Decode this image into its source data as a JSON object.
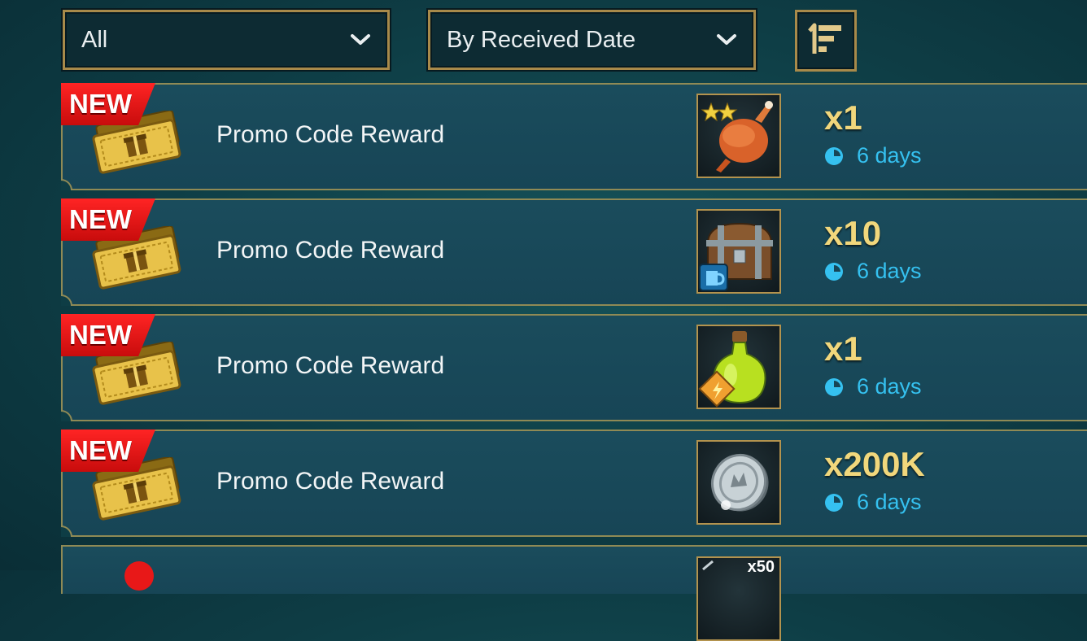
{
  "filters": {
    "category": "All",
    "sort_by": "By Received Date",
    "sort_order_icon": "sort-descending-icon"
  },
  "badge_label": "NEW",
  "rewards": [
    {
      "title": "Promo Code Reward",
      "item_icon": "roast-chicken-icon",
      "quantity": "x1",
      "expiry": "6 days",
      "is_new": true
    },
    {
      "title": "Promo Code Reward",
      "item_icon": "treasure-chest-icon",
      "quantity": "x10",
      "expiry": "6 days",
      "is_new": true
    },
    {
      "title": "Promo Code Reward",
      "item_icon": "energy-potion-icon",
      "quantity": "x1",
      "expiry": "6 days",
      "is_new": true
    },
    {
      "title": "Promo Code Reward",
      "item_icon": "silver-coin-icon",
      "quantity": "x200K",
      "expiry": "6 days",
      "is_new": true
    }
  ],
  "partial_row": {
    "item_badge": "x50"
  },
  "colors": {
    "accent_gold": "#a88a4a",
    "quantity_gold": "#f1d77c",
    "expiry_blue": "#35c1f0",
    "new_badge_red": "#e81818"
  }
}
